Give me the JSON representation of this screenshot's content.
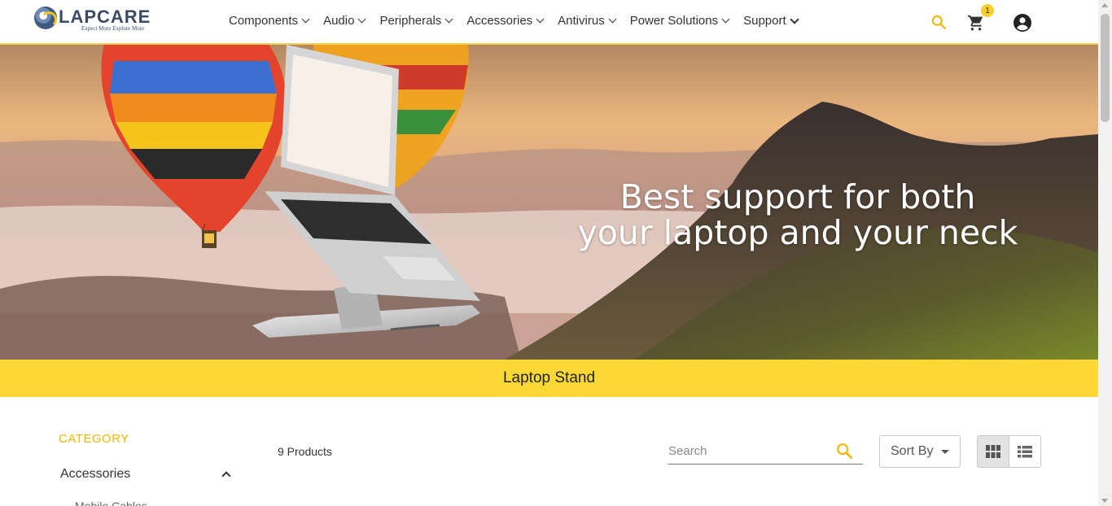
{
  "brand": {
    "name": "LAPCARE",
    "tagline": "Expect More Explore More",
    "accent_color": "#fdd835"
  },
  "nav": {
    "items": [
      {
        "label": "Components"
      },
      {
        "label": "Audio"
      },
      {
        "label": "Peripherals"
      },
      {
        "label": "Accessories"
      },
      {
        "label": "Antivirus"
      },
      {
        "label": "Power Solutions"
      },
      {
        "label": "Support"
      }
    ]
  },
  "header": {
    "cart_count": "1",
    "icons": [
      "search-icon",
      "cart-icon",
      "account-icon"
    ]
  },
  "banner": {
    "line1": "Best support for both",
    "line2": "your laptop and your neck"
  },
  "category_title": "Laptop Stand",
  "sidebar": {
    "heading": "CATEGORY",
    "items": [
      {
        "label": "Accessories",
        "expanded": true
      }
    ],
    "sub_item": "Mobile Cables"
  },
  "toolbar": {
    "product_count": "9 Products",
    "search_placeholder": "Search",
    "sort_label": "Sort By",
    "view_modes": [
      "grid",
      "list"
    ],
    "active_view": "grid"
  }
}
